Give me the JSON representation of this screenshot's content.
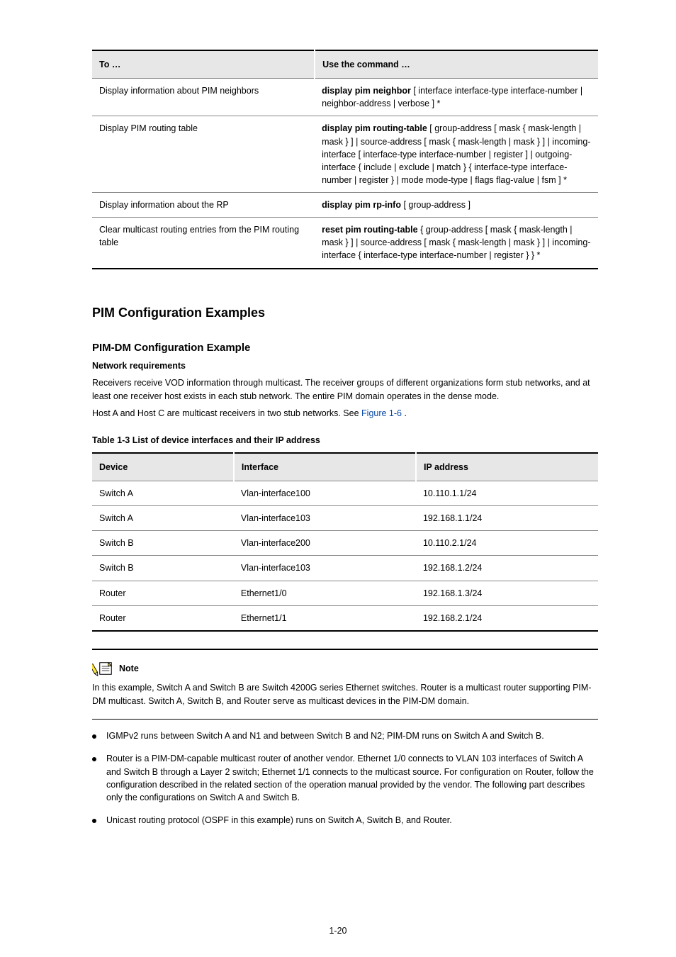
{
  "lookup_table": {
    "header": {
      "to": "To …",
      "use": "Use the command …"
    },
    "rows": [
      {
        "to": "Display information about PIM neighbors",
        "use_cmd": "display pim neighbor",
        "use_args": "[ interface interface-type interface-number | neighbor-address | verbose ] *"
      },
      {
        "to": "Display PIM routing table",
        "use_cmd": "display pim routing-table",
        "use_args": "[ group-address [ mask { mask-length | mask } ] | source-address [ mask { mask-length | mask } ] | incoming-interface [ interface-type interface-number | register ] | outgoing-interface { include | exclude | match } { interface-type interface-number | register } | mode mode-type | flags flag-value | fsm ] *"
      },
      {
        "to": "Display information about the RP",
        "use_cmd": "display pim rp-info",
        "use_args": "[ group-address ]"
      },
      {
        "to": "Clear multicast routing entries from the PIM routing table",
        "use_cmd": "reset pim routing-table",
        "use_args": "{ group-address [ mask { mask-length | mask } ] | source-address [ mask { mask-length | mask } ] | incoming-interface { interface-type interface-number | register } } *"
      }
    ]
  },
  "section_heading": "PIM Configuration Examples",
  "subsection_heading": "PIM-DM Configuration Example",
  "network_req_label": "Network requirements",
  "net_para1": "Receivers receive VOD information through multicast. The receiver groups of different organizations form stub networks, and at least one receiver host exists in each stub network. The entire PIM domain operates in the dense mode.",
  "net_para2_pre": "Host A and Host C are multicast receivers in two stub networks. See ",
  "net_para2_linktext": "Figure 1-6",
  "net_para2_post": ".",
  "table2_title": "Table 1-3 List of device interfaces and their IP address",
  "interfaces_table": {
    "header": {
      "dev": "Device",
      "iface": "Interface",
      "ip": "IP address"
    },
    "rows": [
      {
        "dev": "Switch A",
        "iface": "Vlan-interface100",
        "ip": "10.110.1.1/24"
      },
      {
        "dev": "Switch A",
        "iface": "Vlan-interface103",
        "ip": "192.168.1.1/24"
      },
      {
        "dev": "Switch B",
        "iface": "Vlan-interface200",
        "ip": "10.110.2.1/24"
      },
      {
        "dev": "Switch B",
        "iface": "Vlan-interface103",
        "ip": "192.168.1.2/24"
      },
      {
        "dev": "Router",
        "iface": "Ethernet1/0",
        "ip": "192.168.1.3/24"
      },
      {
        "dev": "Router",
        "iface": "Ethernet1/1",
        "ip": "192.168.2.1/24"
      }
    ]
  },
  "note_label": "Note",
  "note_body": "In this example, Switch A and Switch B are Switch 4200G series Ethernet switches. Router is a multicast router supporting PIM-DM multicast. Switch A, Switch B, and Router serve as multicast devices in the PIM-DM domain.",
  "bullets": [
    "IGMPv2 runs between Switch A and N1 and between Switch B and N2; PIM-DM runs on Switch A and Switch B.",
    "Router is a PIM-DM-capable multicast router of another vendor. Ethernet 1/0 connects to VLAN 103 interfaces of Switch A and Switch B through a Layer 2 switch; Ethernet 1/1 connects to the multicast source. For configuration on Router, follow the configuration described in the related section of the operation manual provided by the vendor. The following part describes only the configurations on Switch A and Switch B.",
    "Unicast routing protocol (OSPF in this example) runs on Switch A, Switch B, and Router."
  ],
  "page_number": "1-20"
}
